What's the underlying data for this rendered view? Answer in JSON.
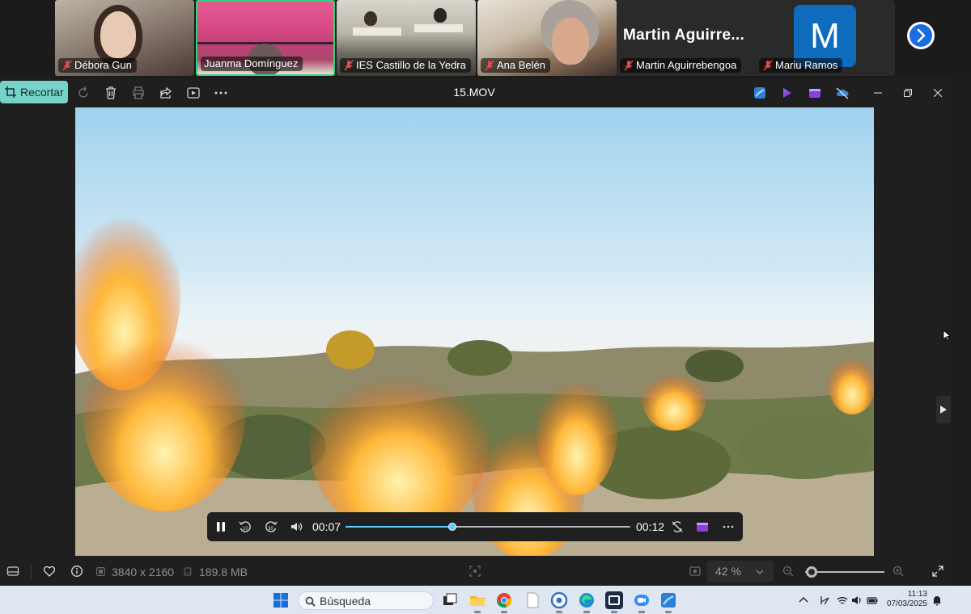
{
  "call": {
    "participants": [
      {
        "name": "Débora Gun",
        "muted": true
      },
      {
        "name": "Juanma Domínguez",
        "muted": false,
        "active_speaker": true
      },
      {
        "name": "IES Castillo de la Yedra",
        "muted": true
      },
      {
        "name": "Ana Belén",
        "muted": true
      }
    ],
    "featured_name": "Martin  Aguirre...",
    "featured_avatar_letter": "M",
    "featured_avatar_color": "#0f6cbd",
    "bottom_names": [
      "Martin Aguirrebengoa",
      "Mariu Ramos"
    ],
    "next_icon": "chevron-right-icon"
  },
  "app": {
    "crop_label": "Recortar",
    "file_title": "15.MOV",
    "toolbar_icons": [
      "rotate-icon",
      "delete-icon",
      "print-icon",
      "share-icon",
      "slideshow-icon",
      "more-icon"
    ],
    "right_icons": [
      "photos-app-icon",
      "clipchamp-icon",
      "video-editor-icon",
      "onedrive-icon"
    ],
    "window_controls": [
      "minimize",
      "restore",
      "close"
    ]
  },
  "player": {
    "current_time": "00:07",
    "total_time": "00:12",
    "progress": 0.375,
    "accent": "#60cdff",
    "buttons": [
      "pause-icon",
      "rewind-10-icon",
      "forward-30-icon",
      "volume-icon",
      "time-cur",
      "repeat-off-icon",
      "clipchamp-icon",
      "more-icon"
    ]
  },
  "status": {
    "dimensions": "3840 x 2160",
    "size": "189.8 MB",
    "zoom": "42 %",
    "zoom_level": 0.08
  },
  "taskbar": {
    "search_placeholder": "Búsqueda",
    "time": "11:13",
    "date": "07/03/2025"
  }
}
